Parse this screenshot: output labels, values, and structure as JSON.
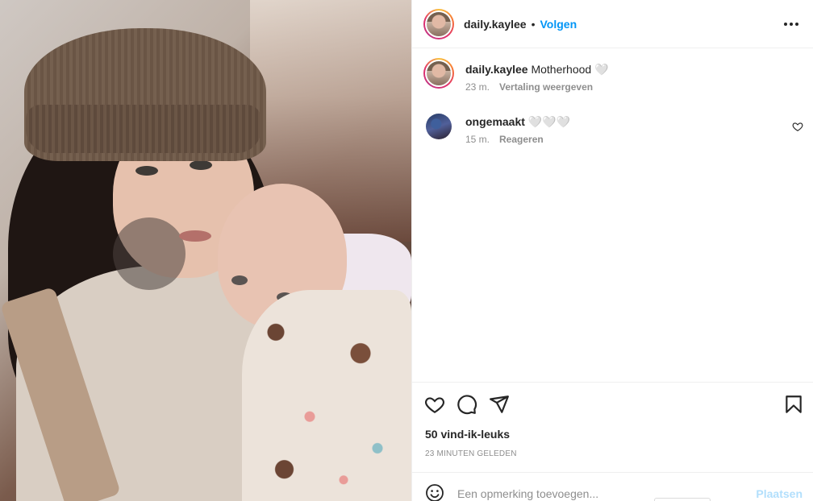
{
  "post": {
    "photo_alt": "Post photo"
  },
  "header": {
    "username": "daily.kaylee",
    "separator": "•",
    "follow_label": "Volgen"
  },
  "caption": {
    "username": "daily.kaylee",
    "text": "Motherhood 🤍",
    "time": "23 m.",
    "translate_label": "Vertaling weergeven"
  },
  "comments": [
    {
      "username": "ongemaakt",
      "text": "🤍🤍🤍",
      "time": "15 m.",
      "reply_label": "Reageren"
    }
  ],
  "stats": {
    "likes": "50 vind-ik-leuks",
    "time_ago": "23 MINUTEN GELEDEN"
  },
  "composer": {
    "placeholder": "Een opmerking toevoegen...",
    "post_label": "Plaatsen"
  },
  "icons": {
    "like": "heart-icon",
    "comment": "comment-icon",
    "share": "send-icon",
    "save": "bookmark-icon",
    "emoji": "emoji-icon",
    "more": "more-horizontal-icon",
    "comment_like": "heart-icon"
  },
  "colors": {
    "accent": "#0095f6",
    "post_disabled": "#b2dffc",
    "muted": "#8e8e8e",
    "text": "#262626"
  }
}
